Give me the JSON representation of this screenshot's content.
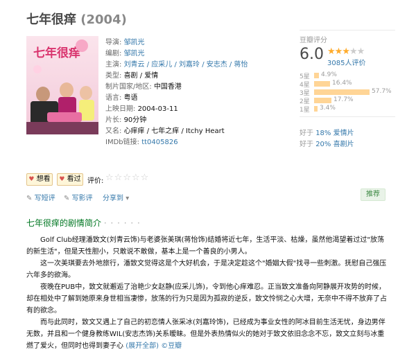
{
  "title": "七年很痒",
  "year": "(2004)",
  "info": [
    {
      "label": "导演:",
      "value": "邹凯光",
      "link": true
    },
    {
      "label": "编剧:",
      "value": "邹凯光",
      "link": true
    },
    {
      "label": "主演:",
      "value": "刘青云 / 应采儿 / 刘嘉玲 / 安志杰 / 蒋怡",
      "link": true
    },
    {
      "label": "类型:",
      "value": "喜剧 / 爱情",
      "link": false
    },
    {
      "label": "制片国家/地区:",
      "value": "中国香港",
      "link": false
    },
    {
      "label": "语言:",
      "value": "粤语",
      "link": false
    },
    {
      "label": "上映日期:",
      "value": "2004-03-11",
      "link": false
    },
    {
      "label": "片长:",
      "value": "90分钟",
      "link": false
    },
    {
      "label": "又名:",
      "value": "心痒痒 / 七年之痒 / Itchy Heart",
      "link": false
    },
    {
      "label": "IMDb链接:",
      "value": "tt0405826",
      "link": true
    }
  ],
  "rating": {
    "header": "豆瓣评分",
    "score": "6.0",
    "stars": 3,
    "votes": "3085人评价",
    "breakdown": [
      {
        "label": "5星",
        "pct": "4.9%",
        "value": 4.9
      },
      {
        "label": "4星",
        "pct": "16.4%",
        "value": 16.4
      },
      {
        "label": "3星",
        "pct": "57.7%",
        "value": 57.7
      },
      {
        "label": "2星",
        "pct": "17.7%",
        "value": 17.7
      },
      {
        "label": "1星",
        "pct": "3.4%",
        "value": 3.4
      }
    ],
    "better": [
      {
        "prefix": "好于",
        "pct": "18%",
        "genre": "爱情片"
      },
      {
        "prefix": "好于",
        "pct": "20%",
        "genre": "喜剧片"
      }
    ]
  },
  "actions": {
    "want": "想看",
    "watched": "看过",
    "rate_label": "评价:",
    "write_review_short": "写短评",
    "write_review": "写影评",
    "share": "分享到",
    "recommend": "推荐"
  },
  "summary": {
    "heading": "七年很痒的剧情简介",
    "dots": "· · · · · ·",
    "p1": "Golf Club经理潘致文(刘青云饰)与老婆张美琪(蒋怡饰)结婚将近七年，生活平淡、枯燥，虽然他渴望着过过\"放荡的新生活\"，但是天性胆小，只敢说不敢做，基本上是一个善良的小男人。",
    "p2": "这一次美琪要去外地旅行，潘致文觉得这是个大好机会，于是决定趁这个\"婚姻大假\"找寻一些刺激。抚慰自己强压六年多的欲海。",
    "p3": "夜晚在PUB中，致文就邂逅了治艳少女赵静(应采儿饰)，令到他心痒难忍。正当致文准备向阿静展开攻势的时候，却在相处中了解到她原来身世相当凄惨，放荡的行为只是因为孤寂的逆反，致文怜悯之心大增，无奈中不得不放弃了占有的欲念。",
    "p4": "而与此同时，致文又遇上了自己的初恋情人张采冰(刘嘉玲饰)，已经成为事业女性的阿冰目前生活无忧，身边男伴无数，并且和一个健身教练WIL(安志杰饰)关系暧昧。但是外表热情似火的她对于致文依旧念念不忘，致文立刻与冰重燃了爱火，但同时也得到妻子心",
    "expand": "(展开全部)",
    "copyright": "©豆瓣"
  }
}
